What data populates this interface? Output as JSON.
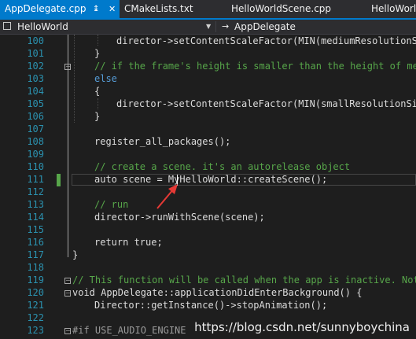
{
  "tabs": [
    {
      "label": "AppDelegate.cpp",
      "active": true
    },
    {
      "label": "CMakeLists.txt",
      "active": false
    },
    {
      "label": "HelloWorldScene.cpp",
      "active": false
    },
    {
      "label": "HelloWorl",
      "active": false
    }
  ],
  "tab_pin_icon": "pin-icon",
  "tab_close_icon": "close-icon",
  "navbar": {
    "project_combo": "HelloWorld",
    "scope_combo": "AppDelegate"
  },
  "editor": {
    "lines": [
      {
        "num": "100",
        "text": "director->setContentScaleFactor(MIN(mediumResolutionSiz"
      },
      {
        "num": "101",
        "text": "}"
      },
      {
        "num": "102",
        "text": "// if the frame's height is smaller than the height of medi"
      },
      {
        "num": "103",
        "text": "else"
      },
      {
        "num": "104",
        "text": "{"
      },
      {
        "num": "105",
        "text": "director->setContentScaleFactor(MIN(smallResolutionSize"
      },
      {
        "num": "106",
        "text": "}"
      },
      {
        "num": "107",
        "text": ""
      },
      {
        "num": "108",
        "text": "register_all_packages();"
      },
      {
        "num": "109",
        "text": ""
      },
      {
        "num": "110",
        "text": "// create a scene. it's an autorelease object"
      },
      {
        "num": "111",
        "text": "auto scene = MyHelloWorld::createScene();"
      },
      {
        "num": "112",
        "text": ""
      },
      {
        "num": "113",
        "text": "// run"
      },
      {
        "num": "114",
        "text": "director->runWithScene(scene);"
      },
      {
        "num": "115",
        "text": ""
      },
      {
        "num": "116",
        "text": "return true;"
      },
      {
        "num": "117",
        "text": "}"
      },
      {
        "num": "118",
        "text": ""
      },
      {
        "num": "119",
        "text": "// This function will be called when the app is inactive. Note,"
      },
      {
        "num": "120",
        "text": "void AppDelegate::applicationDidEnterBackground() {"
      },
      {
        "num": "121",
        "text": "Director::getInstance()->stopAnimation();"
      },
      {
        "num": "122",
        "text": ""
      },
      {
        "num": "123",
        "text": "#if USE_AUDIO_ENGINE"
      }
    ]
  },
  "watermark": "https://blog.csdn.net/sunnyboychina",
  "colors": {
    "accent": "#007acc",
    "keyword": "#569cd6",
    "comment": "#57a64a",
    "line_number": "#2b91af",
    "annotation_arrow": "#e53935"
  }
}
